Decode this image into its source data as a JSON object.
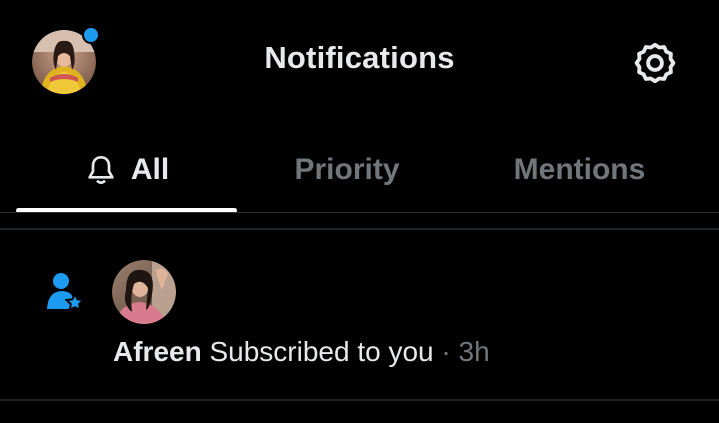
{
  "header": {
    "title": "Notifications",
    "avatar_icon": "user-avatar",
    "settings_icon": "gear-icon",
    "unread_dot_color": "#1d9bf0"
  },
  "tabs": [
    {
      "label": "All",
      "icon": "bell-icon",
      "active": true
    },
    {
      "label": "Priority",
      "active": false
    },
    {
      "label": "Mentions",
      "active": false
    }
  ],
  "notifications": [
    {
      "icon": "person-star-icon",
      "icon_color": "#1d9bf0",
      "name": "Afreen",
      "action": "Subscribed to you",
      "separator": "·",
      "time": "3h"
    }
  ],
  "colors": {
    "background": "#000000",
    "primary_text": "#e7e9ea",
    "secondary_text": "#71767b",
    "accent": "#1d9bf0",
    "border": "#2f3336"
  }
}
